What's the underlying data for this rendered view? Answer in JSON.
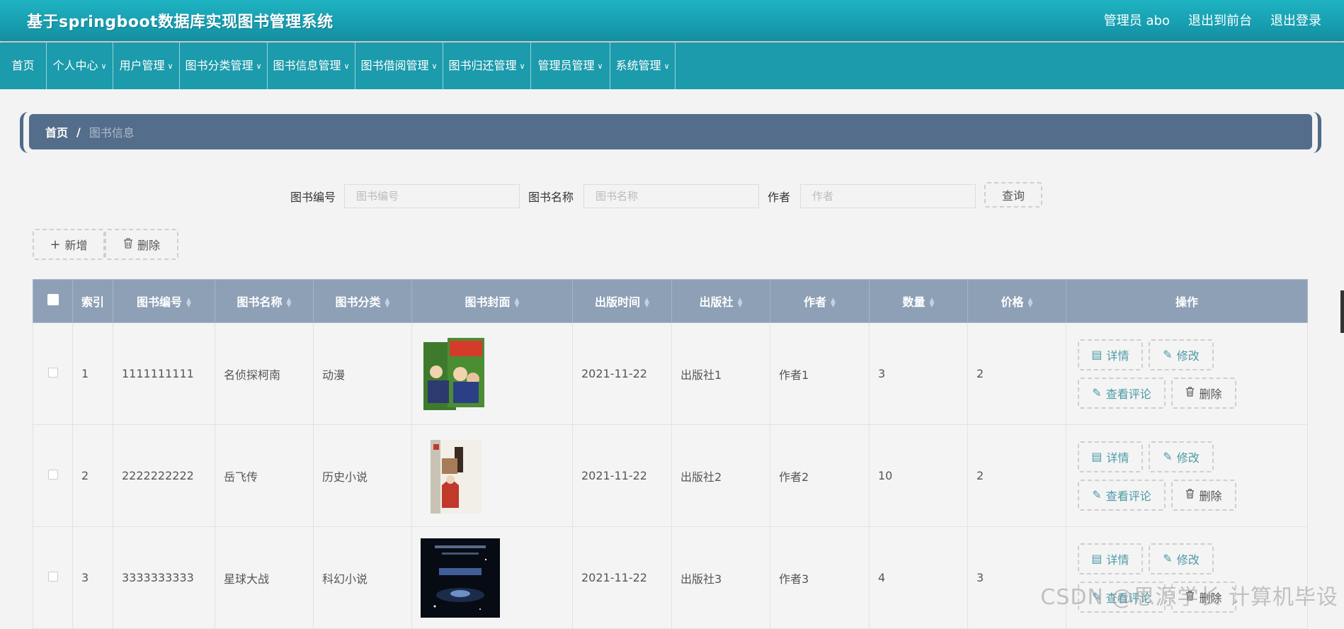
{
  "header": {
    "title": "基于springboot数据库实现图书管理系统",
    "user_label": "管理员 abo",
    "back_to_front": "退出到前台",
    "logout": "退出登录"
  },
  "nav": {
    "items": [
      "首页",
      "个人中心",
      "用户管理",
      "图书分类管理",
      "图书信息管理",
      "图书借阅管理",
      "图书归还管理",
      "管理员管理",
      "系统管理"
    ]
  },
  "breadcrumb": {
    "home": "首页",
    "separator": "/",
    "current": "图书信息"
  },
  "search": {
    "fields": [
      {
        "label": "图书编号",
        "placeholder": "图书编号"
      },
      {
        "label": "图书名称",
        "placeholder": "图书名称"
      },
      {
        "label": "作者",
        "placeholder": "作者"
      }
    ],
    "query_label": "查询"
  },
  "actions": {
    "add_label": "新增",
    "delete_label": "删除"
  },
  "table": {
    "headers": {
      "index": "索引",
      "book_no": "图书编号",
      "book_name": "图书名称",
      "category": "图书分类",
      "cover": "图书封面",
      "pub_date": "出版时间",
      "publisher": "出版社",
      "author": "作者",
      "quantity": "数量",
      "price": "价格",
      "operations": "操作"
    },
    "op_labels": {
      "detail": "详情",
      "edit": "修改",
      "comments": "查看评论",
      "delete": "删除"
    },
    "rows": [
      {
        "index": "1",
        "book_no": "1111111111",
        "book_name": "名侦探柯南",
        "category": "动漫",
        "pub_date": "2021-11-22",
        "publisher": "出版社1",
        "author": "作者1",
        "quantity": "3",
        "price": "2"
      },
      {
        "index": "2",
        "book_no": "2222222222",
        "book_name": "岳飞传",
        "category": "历史小说",
        "pub_date": "2021-11-22",
        "publisher": "出版社2",
        "author": "作者2",
        "quantity": "10",
        "price": "2"
      },
      {
        "index": "3",
        "book_no": "3333333333",
        "book_name": "星球大战",
        "category": "科幻小说",
        "pub_date": "2021-11-22",
        "publisher": "出版社3",
        "author": "作者3",
        "quantity": "4",
        "price": "3"
      }
    ]
  },
  "watermark": "CSDN @思源学长 计算机毕设",
  "colors": {
    "header": "#17a0b2",
    "nav": "#1b9bab",
    "breadcrumb": "#546d8b",
    "table_header": "#8da0b6",
    "op_text": "#4b9aa6"
  }
}
